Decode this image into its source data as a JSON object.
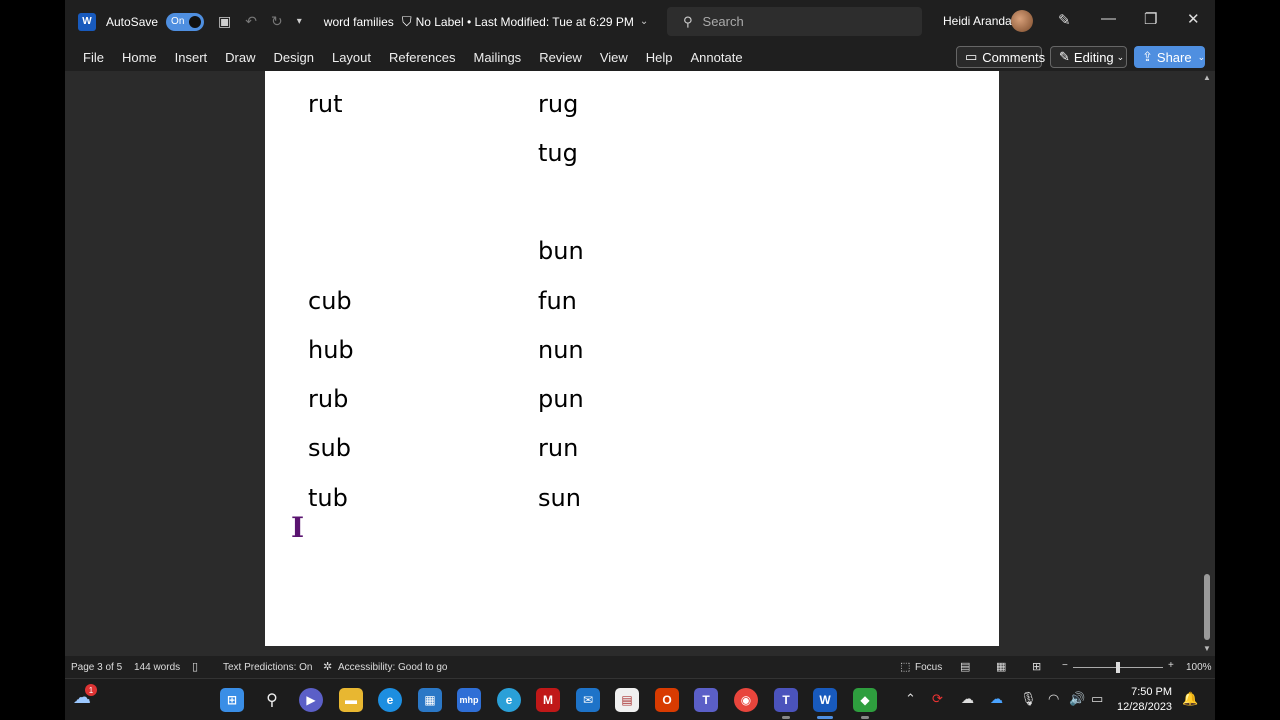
{
  "titlebar": {
    "app_icon": "W",
    "autosave_label": "AutoSave",
    "autosave_state": "On",
    "doc_name": "word families",
    "label_info": "No Label • Last Modified: Tue at 6:29 PM",
    "search_placeholder": "Search",
    "user_name": "Heidi Aranda"
  },
  "menu": [
    "File",
    "Home",
    "Insert",
    "Draw",
    "Design",
    "Layout",
    "References",
    "Mailings",
    "Review",
    "View",
    "Help",
    "Annotate"
  ],
  "actions": {
    "comments": "Comments",
    "editing": "Editing",
    "share": "Share"
  },
  "document": {
    "column1": [
      "rut",
      "cub",
      "hub",
      "rub",
      "sub",
      "tub"
    ],
    "column2": [
      "rug",
      "tug",
      "bun",
      "fun",
      "nun",
      "pun",
      "run",
      "sun"
    ],
    "cursor_glyph": "I"
  },
  "status": {
    "page": "Page 3 of 5",
    "words": "144 words",
    "predictions": "Text Predictions: On",
    "accessibility": "Accessibility: Good to go",
    "focus": "Focus",
    "zoom": "100%",
    "zoom_minus": "−",
    "zoom_plus": "+"
  },
  "taskbar": {
    "notification_count": "1",
    "time": "7:50 PM",
    "date": "12/28/2023",
    "apps": [
      "windows-start",
      "search",
      "meet",
      "file-explorer",
      "edge",
      "store",
      "mhp",
      "edge-beta",
      "mcafee",
      "mail",
      "sticky-notes",
      "office",
      "teams",
      "chrome",
      "teams-work",
      "word",
      "camtasia"
    ]
  },
  "colors": {
    "accent": "#4f8fe0",
    "cursor": "#5a1470",
    "page": "#ffffff",
    "canvas": "#2b2b2b"
  }
}
